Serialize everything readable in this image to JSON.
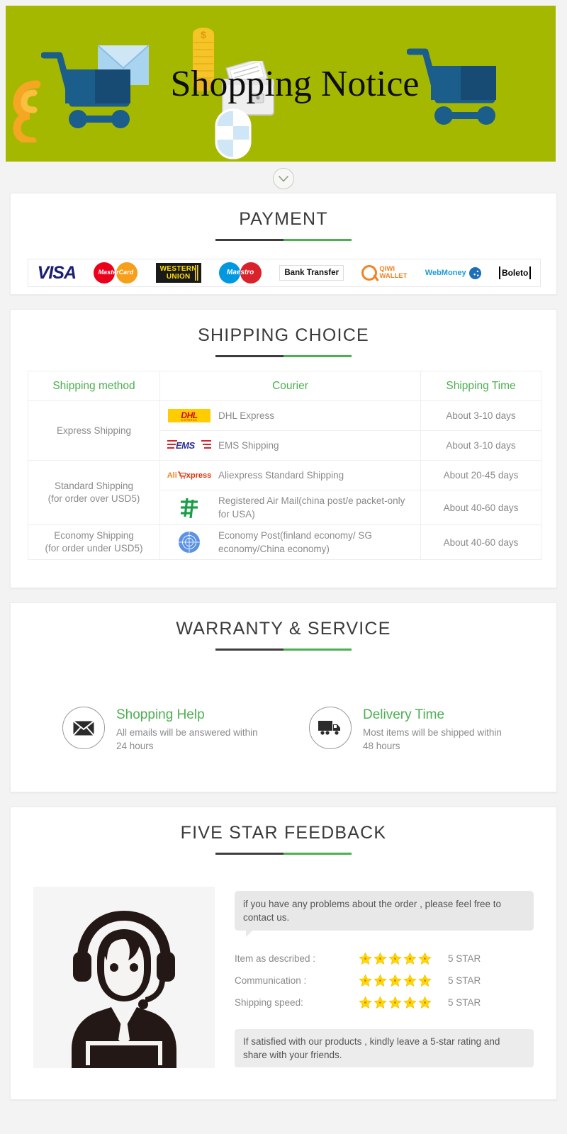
{
  "banner": {
    "title": "Shopping Notice"
  },
  "expand_button": {
    "icon": "chevron-down-icon"
  },
  "payment": {
    "title": "PAYMENT",
    "methods": [
      {
        "name": "VISA",
        "id": "visa"
      },
      {
        "name": "MasterCard",
        "id": "mastercard"
      },
      {
        "name": "WESTERN UNION",
        "line1": "WESTERN",
        "line2": "UNION",
        "id": "western-union"
      },
      {
        "name": "Maestro",
        "id": "maestro"
      },
      {
        "name": "Bank Transfer",
        "id": "bank-transfer"
      },
      {
        "name": "QIWI WALLET",
        "line1": "QIWI",
        "line2": "WALLET",
        "id": "qiwi-wallet"
      },
      {
        "name": "WebMoney",
        "id": "webmoney"
      },
      {
        "name": "Boleto",
        "id": "boleto"
      }
    ]
  },
  "shipping": {
    "title": "SHIPPING CHOICE",
    "headers": [
      "Shipping method",
      "Courier",
      "Shipping Time"
    ],
    "groups": [
      {
        "method": "Express Shipping",
        "method_note": "",
        "rows": [
          {
            "logo": "dhl-logo",
            "courier": "DHL Express",
            "time": "About 3-10 days"
          },
          {
            "logo": "ems-logo",
            "courier": "EMS Shipping",
            "time": "About 3-10 days"
          }
        ]
      },
      {
        "method": "Standard Shipping",
        "method_note": "(for order over USD5)",
        "rows": [
          {
            "logo": "aliexpress-logo",
            "courier": "Aliexpress Standard Shipping",
            "time": "About 20-45 days"
          },
          {
            "logo": "china-post-logo",
            "courier": "Registered Air Mail(china post/e packet-only for USA)",
            "time": "About 40-60 days"
          }
        ]
      },
      {
        "method": "Economy Shipping",
        "method_note": "(for order under USD5)",
        "rows": [
          {
            "logo": "un-post-logo",
            "courier": "Economy Post(finland economy/ SG economy/China economy)",
            "time": "About 40-60 days"
          }
        ]
      }
    ],
    "logo_text": {
      "dhl": "DHL",
      "dhl_sub": "EXPRESS",
      "ems": "EMS",
      "ali_1": "Ali",
      "ali_2": "xpress"
    }
  },
  "warranty": {
    "title": "WARRANTY & SERVICE",
    "items": [
      {
        "icon": "envelope-icon",
        "title": "Shopping Help",
        "desc": "All emails will be answered within 24 hours"
      },
      {
        "icon": "truck-icon",
        "title": "Delivery Time",
        "desc": "Most items will be shipped within 48 hours"
      }
    ]
  },
  "feedback": {
    "title": "FIVE STAR FEEDBACK",
    "agent_icon": "customer-service-agent-icon",
    "bubble_top": "if you have any problems about the order , please feel free to contact us.",
    "ratings": [
      {
        "label": "Item as described :",
        "stars": 5,
        "value": "5 STAR"
      },
      {
        "label": "Communication :",
        "stars": 5,
        "value": "5 STAR"
      },
      {
        "label": "Shipping speed:",
        "stars": 5,
        "value": "5 STAR"
      }
    ],
    "bubble_bottom": "If satisfied with our products , kindly leave a 5-star rating and share with your friends."
  },
  "colors": {
    "banner_green": "#a5b800",
    "accent_green": "#4caf50",
    "rule_dark": "#3d3d3d",
    "body_text": "#8a8a8a",
    "title_text": "#3a3a3a",
    "star_yellow": "#ffd900"
  }
}
